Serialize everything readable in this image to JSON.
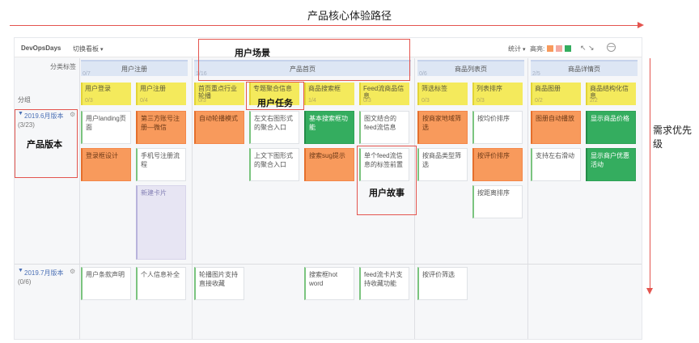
{
  "annotations": {
    "top_title": "产品核心体验路径",
    "right_label": "需求优先级",
    "scene_label": "用户场景",
    "task_label": "用户任务",
    "version_label": "产品版本",
    "story_label": "用户故事",
    "arrow_color": "#e4554f"
  },
  "toolbar": {
    "app_name": "DevOpsDays",
    "switch_board": "切换看板",
    "stats": "统计",
    "highlight": "高亮:",
    "highlight_colors": [
      "#f89a5c",
      "#f4a8a0",
      "#34ad5f"
    ],
    "expand_icon": "↖ ↘",
    "collapse_icon": "↘ ↖",
    "zoom_icon": "—"
  },
  "rows": {
    "category_tag": "分类标签",
    "group": "分组"
  },
  "epics": [
    {
      "title": "用户注册",
      "count": "0/7"
    },
    {
      "title": "产品首页",
      "count": "1/16"
    },
    {
      "title": "商品列表页",
      "count": "0/6"
    },
    {
      "title": "商品详情页",
      "count": "2/5"
    }
  ],
  "features": [
    {
      "title": "用户登录",
      "count": "0/3"
    },
    {
      "title": "用户注册",
      "count": "0/4"
    },
    {
      "title": "首页重点行业轮播",
      "count": "0/3"
    },
    {
      "title": "专题聚合信息",
      "count": ""
    },
    {
      "title": "商品搜索框",
      "count": "1/4"
    },
    {
      "title": "Feed流商品信息",
      "count": "0/3"
    },
    {
      "title": "筛选标签",
      "count": "0/3"
    },
    {
      "title": "列表排序",
      "count": "0/3"
    },
    {
      "title": "商品图册",
      "count": "0/2"
    },
    {
      "title": "商品结构化信息",
      "count": "2/2"
    }
  ],
  "releases": [
    {
      "title": "2019.6月版本",
      "count": "(3/23)"
    },
    {
      "title": "2019.7月版本",
      "count": "(0/6)"
    }
  ],
  "stories_r1": [
    "用户landing页面",
    "第三方账号注册—微信",
    "自动轮播模式",
    "左文右图形式的聚合入口",
    "基本搜索框功能",
    "图文结合的feed流信息",
    "按商家地域筛选",
    "按均价排序",
    "图册自动播放",
    "显示商品价格",
    "登录框设计",
    "手机号注册流程",
    "上文下图形式的聚合入口",
    "搜索sug提示",
    "单个feed流信息的标签前置",
    "按商品类型筛选",
    "按评价排序",
    "支持左右滑动",
    "显示商户优惠活动",
    "按距离排序"
  ],
  "new_card": "新建卡片",
  "stories_r2": [
    "用户条款声明",
    "个人信息补全",
    "轮播图片支持直接收藏",
    "搜索框hot word",
    "feed流卡片支持收藏功能",
    "按评价筛选"
  ]
}
